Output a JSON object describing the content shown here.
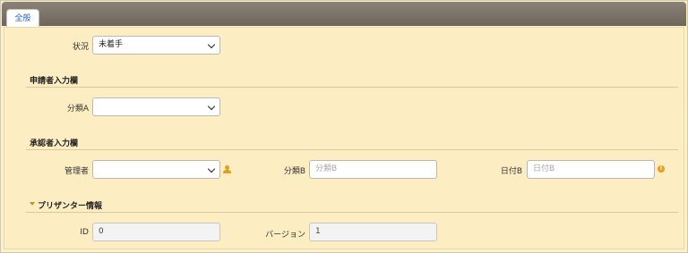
{
  "tabs": [
    {
      "label": "全般",
      "active": true
    }
  ],
  "fields": {
    "status": {
      "label": "状況",
      "value": "未着手"
    },
    "category_a": {
      "label": "分類A",
      "value": ""
    },
    "manager": {
      "label": "管理者",
      "value": ""
    },
    "category_b": {
      "label": "分類B",
      "value": "",
      "placeholder": "分類B"
    },
    "date_b": {
      "label": "日付B",
      "value": "",
      "placeholder": "日付B"
    },
    "id": {
      "label": "ID",
      "value": "0"
    },
    "version": {
      "label": "バージョン",
      "value": "1"
    }
  },
  "sections": {
    "applicant": "申請者入力欄",
    "approver": "承認者入力欄",
    "preset": "プリザンター情報"
  },
  "colors": {
    "background": "#fdedc2",
    "tab_text": "#2f5fb5",
    "accent_icon": "#e0a020"
  },
  "icons": {
    "manager_assist": "user-icon",
    "date_help": "help-icon",
    "section_toggle": "caret-down-icon"
  }
}
